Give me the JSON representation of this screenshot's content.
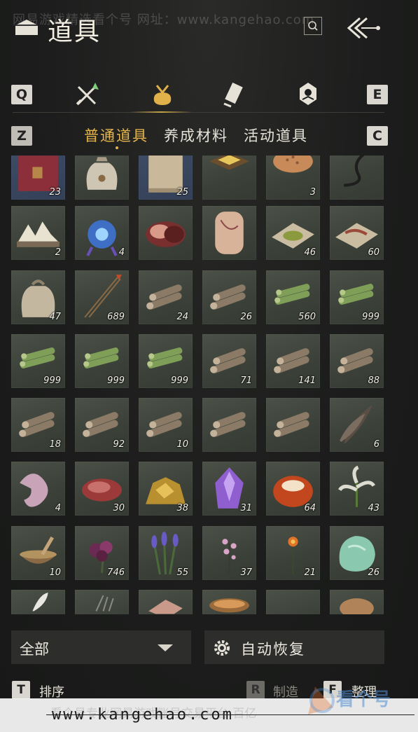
{
  "header": {
    "watermark": "网易游戏精选看个号  网址：www.kangehao.com",
    "title": "道具"
  },
  "category_keys": {
    "left": "Q",
    "right": "E"
  },
  "sub_keys": {
    "left": "Z",
    "right": "C"
  },
  "categories": [
    "weapons-icon",
    "pouch-icon",
    "scroll-icon",
    "badge-icon"
  ],
  "subtabs": [
    "普通道具",
    "养成材料",
    "活动道具"
  ],
  "items": [
    {
      "icon": "red-envelope-icon",
      "count": "23"
    },
    {
      "icon": "rice-sack-icon",
      "count": ""
    },
    {
      "icon": "paper-scroll-icon",
      "count": "25"
    },
    {
      "icon": "cake-plate-icon",
      "count": ""
    },
    {
      "icon": "flatbread-icon",
      "count": "3"
    },
    {
      "icon": "whip-icon",
      "count": ""
    },
    {
      "icon": "rock-mountain-icon",
      "count": "2"
    },
    {
      "icon": "blue-pouch-icon",
      "count": "4"
    },
    {
      "icon": "rouge-box-icon",
      "count": ""
    },
    {
      "icon": "lantern-icon",
      "count": ""
    },
    {
      "icon": "powder-paper-icon",
      "count": "46"
    },
    {
      "icon": "worm-paper-icon",
      "count": "60"
    },
    {
      "icon": "cloth-sack-icon",
      "count": "47"
    },
    {
      "icon": "arrows-icon",
      "count": "689"
    },
    {
      "icon": "logs-icon",
      "count": "24"
    },
    {
      "icon": "logs-icon",
      "count": "26"
    },
    {
      "icon": "bamboo-icon",
      "count": "560"
    },
    {
      "icon": "bamboo-icon",
      "count": "999"
    },
    {
      "icon": "bamboo-icon",
      "count": "999"
    },
    {
      "icon": "bamboo-icon",
      "count": "999"
    },
    {
      "icon": "bamboo-icon",
      "count": "999"
    },
    {
      "icon": "logs-icon",
      "count": "71"
    },
    {
      "icon": "logs-icon",
      "count": "141"
    },
    {
      "icon": "logs-icon",
      "count": "88"
    },
    {
      "icon": "logs-icon",
      "count": "18"
    },
    {
      "icon": "logs-icon",
      "count": "92"
    },
    {
      "icon": "logs-icon",
      "count": "10"
    },
    {
      "icon": "logs-icon",
      "count": ""
    },
    {
      "icon": "logs-icon",
      "count": ""
    },
    {
      "icon": "feathers-icon",
      "count": "6"
    },
    {
      "icon": "pink-fabric-icon",
      "count": "4"
    },
    {
      "icon": "meat-icon",
      "count": "30"
    },
    {
      "icon": "gold-ore-icon",
      "count": "38"
    },
    {
      "icon": "purple-crystal-icon",
      "count": "31"
    },
    {
      "icon": "amber-stone-icon",
      "count": "64"
    },
    {
      "icon": "white-herb-icon",
      "count": "43"
    },
    {
      "icon": "mortar-icon",
      "count": "10"
    },
    {
      "icon": "purple-flower-icon",
      "count": "746"
    },
    {
      "icon": "lavender-icon",
      "count": "55"
    },
    {
      "icon": "pink-blossom-icon",
      "count": "37"
    },
    {
      "icon": "orange-flower-icon",
      "count": "21"
    },
    {
      "icon": "jade-stone-icon",
      "count": "26"
    },
    {
      "icon": "white-feather-icon",
      "count": ""
    },
    {
      "icon": "grass-icon",
      "count": ""
    },
    {
      "icon": "cloth-icon",
      "count": ""
    },
    {
      "icon": "bowl-icon",
      "count": ""
    },
    {
      "icon": "empty-icon",
      "count": ""
    },
    {
      "icon": "fur-icon",
      "count": ""
    }
  ],
  "filter": {
    "label": "全部"
  },
  "auto_restore": {
    "label": "自动恢复"
  },
  "actions": {
    "sort_key": "T",
    "sort_label": "排序",
    "craft_key": "R",
    "craft_label": "制造",
    "organize_key": "F",
    "organize_label": "整理"
  },
  "footer": {
    "url": "www.kangehao.com",
    "ghost": "看个号专业网易游戏账号交易平台 百亿",
    "logo_text": "看个号"
  },
  "colors": {
    "accent": "#e5b54f",
    "slot": "#414740"
  }
}
